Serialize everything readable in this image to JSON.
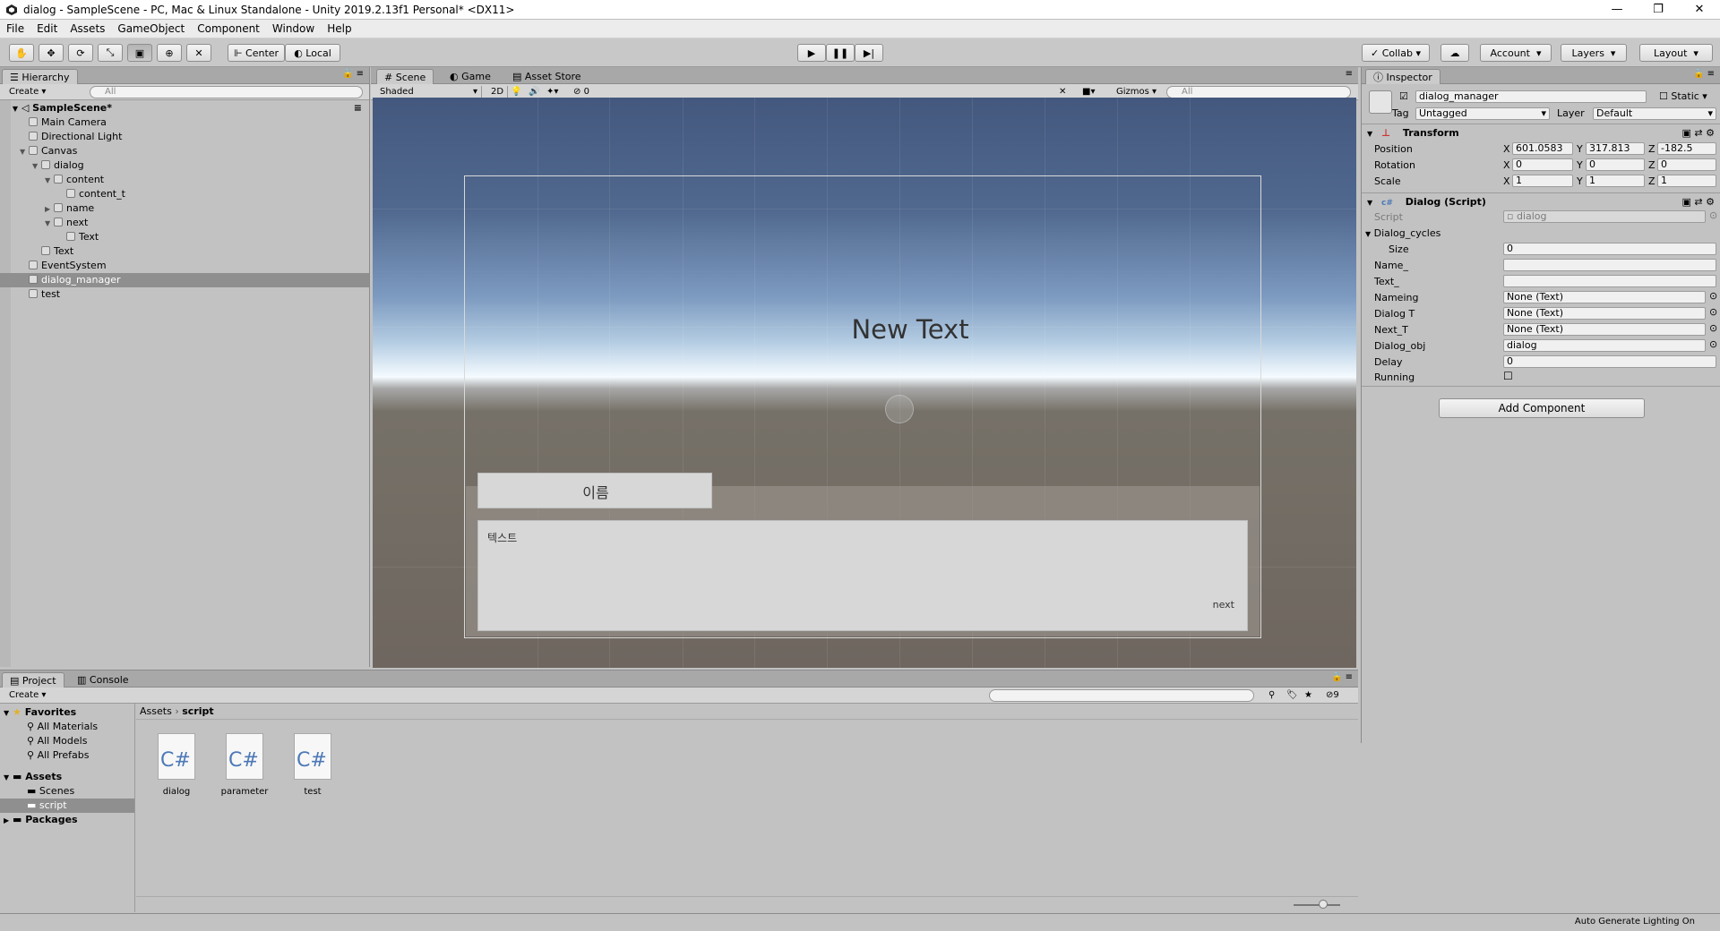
{
  "window": {
    "title": "dialog - SampleScene - PC, Mac & Linux Standalone - Unity 2019.2.13f1 Personal* <DX11>",
    "controls": [
      "—",
      "❐",
      "✕"
    ]
  },
  "menu": [
    "File",
    "Edit",
    "Assets",
    "GameObject",
    "Component",
    "Window",
    "Help"
  ],
  "toolbar": {
    "pivot": "Center",
    "space": "Local",
    "collab": "Collab",
    "account": "Account",
    "layers": "Layers",
    "layout": "Layout"
  },
  "hierarchy": {
    "tab": "Hierarchy",
    "create": "Create",
    "search_placeholder": "All",
    "scene": "SampleScene*",
    "items": [
      {
        "label": "Main Camera",
        "depth": 1,
        "arrow": ""
      },
      {
        "label": "Directional Light",
        "depth": 1,
        "arrow": ""
      },
      {
        "label": "Canvas",
        "depth": 1,
        "arrow": "open"
      },
      {
        "label": "dialog",
        "depth": 2,
        "arrow": "open"
      },
      {
        "label": "content",
        "depth": 3,
        "arrow": "open"
      },
      {
        "label": "content_t",
        "depth": 4,
        "arrow": ""
      },
      {
        "label": "name",
        "depth": 3,
        "arrow": "closed"
      },
      {
        "label": "next",
        "depth": 3,
        "arrow": "open"
      },
      {
        "label": "Text",
        "depth": 4,
        "arrow": ""
      },
      {
        "label": "Text",
        "depth": 2,
        "arrow": ""
      },
      {
        "label": "EventSystem",
        "depth": 1,
        "arrow": ""
      },
      {
        "label": "dialog_manager",
        "depth": 1,
        "arrow": "",
        "selected": true
      },
      {
        "label": "test",
        "depth": 1,
        "arrow": ""
      }
    ]
  },
  "scene": {
    "tabs": [
      "Scene",
      "Game",
      "Asset Store"
    ],
    "shading": "Shaded",
    "mode_2d": "2D",
    "hidden_count": "0",
    "gizmos": "Gizmos",
    "search_placeholder": "All",
    "new_text": "New Text",
    "name_box": "이름",
    "content_text": "텍스트",
    "next_text": "next"
  },
  "inspector": {
    "tab": "Inspector",
    "object_name": "dialog_manager",
    "static": "Static",
    "tag_label": "Tag",
    "tag_value": "Untagged",
    "layer_label": "Layer",
    "layer_value": "Default",
    "transform": {
      "title": "Transform",
      "position_label": "Position",
      "rotation_label": "Rotation",
      "scale_label": "Scale",
      "position": {
        "x": "601.0583",
        "y": "317.813",
        "z": "-182.5"
      },
      "rotation": {
        "x": "0",
        "y": "0",
        "z": "0"
      },
      "scale": {
        "x": "1",
        "y": "1",
        "z": "1"
      }
    },
    "dialog_script": {
      "title": "Dialog (Script)",
      "script_label": "Script",
      "script_value": "dialog",
      "cycles_label": "Dialog_cycles",
      "size_label": "Size",
      "size_value": "0",
      "fields": [
        {
          "label": "Name_",
          "value": "",
          "picker": false
        },
        {
          "label": "Text_",
          "value": "",
          "picker": false
        },
        {
          "label": "Nameing",
          "value": "None (Text)",
          "picker": true
        },
        {
          "label": "Dialog T",
          "value": "None (Text)",
          "picker": true
        },
        {
          "label": "Next_T",
          "value": "None (Text)",
          "picker": true
        },
        {
          "label": "Dialog_obj",
          "value": "dialog",
          "picker": true
        },
        {
          "label": "Delay",
          "value": "0",
          "picker": false
        }
      ],
      "running_label": "Running"
    },
    "add_component": "Add Component"
  },
  "project": {
    "tabs": [
      "Project",
      "Console"
    ],
    "create": "Create",
    "count": "9",
    "favorites_label": "Favorites",
    "favorites": [
      "All Materials",
      "All Models",
      "All Prefabs"
    ],
    "assets_label": "Assets",
    "asset_folders": [
      "Scenes",
      "script"
    ],
    "packages_label": "Packages",
    "breadcrumb": [
      "Assets",
      "script"
    ],
    "files": [
      {
        "name": "dialog",
        "icon": "C#"
      },
      {
        "name": "parameter",
        "icon": "C#"
      },
      {
        "name": "test",
        "icon": "C#"
      }
    ]
  },
  "status": {
    "right": "Auto Generate Lighting On"
  }
}
